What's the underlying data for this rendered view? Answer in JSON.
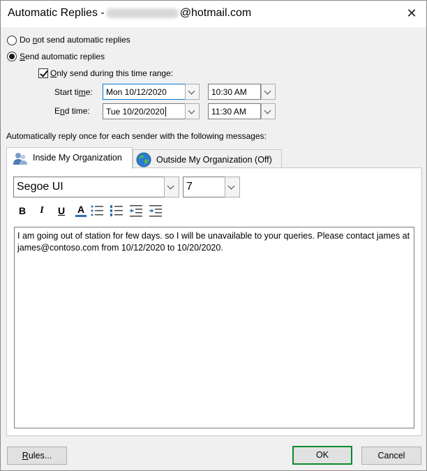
{
  "window": {
    "title_prefix": "Automatic Replies -",
    "title_suffix": "@hotmail.com",
    "close_glyph": "✕"
  },
  "options": {
    "do_not_send": {
      "pre": "Do ",
      "u": "n",
      "post": "ot send automatic replies",
      "checked": false
    },
    "send": {
      "pre": "",
      "u": "S",
      "post": "end automatic replies",
      "checked": true
    },
    "time_range": {
      "pre": "",
      "u": "O",
      "post": "nly send during this time range:",
      "checked": true
    }
  },
  "start": {
    "label_pre": "Start ti",
    "label_u": "m",
    "label_post": "e:",
    "date": "Mon 10/12/2020",
    "time": "10:30 AM"
  },
  "end": {
    "label_pre": "E",
    "label_u": "n",
    "label_post": "d time:",
    "date": "Tue 10/20/2020",
    "time": "11:30 AM"
  },
  "reply_instruction": "Automatically reply once for each sender with the following messages:",
  "tabs": [
    {
      "label": "Inside My Organization",
      "icon": "people-icon",
      "active": true
    },
    {
      "label": "Outside My Organization (Off)",
      "icon": "globe-icon",
      "active": false
    }
  ],
  "format": {
    "font": "Segoe UI",
    "size": "7",
    "bold": "B",
    "italic": "I",
    "underline": "U",
    "font_color": "A",
    "font_color_value": "#2e6fb5"
  },
  "message": "I am going out of station for few days. so I will be unavailable to your queries. Please contact james at james@contoso.com from 10/12/2020 to 10/20/2020.",
  "buttons": {
    "rules_pre": "",
    "rules_u": "R",
    "rules_post": "ules...",
    "ok": "OK",
    "cancel": "Cancel"
  }
}
